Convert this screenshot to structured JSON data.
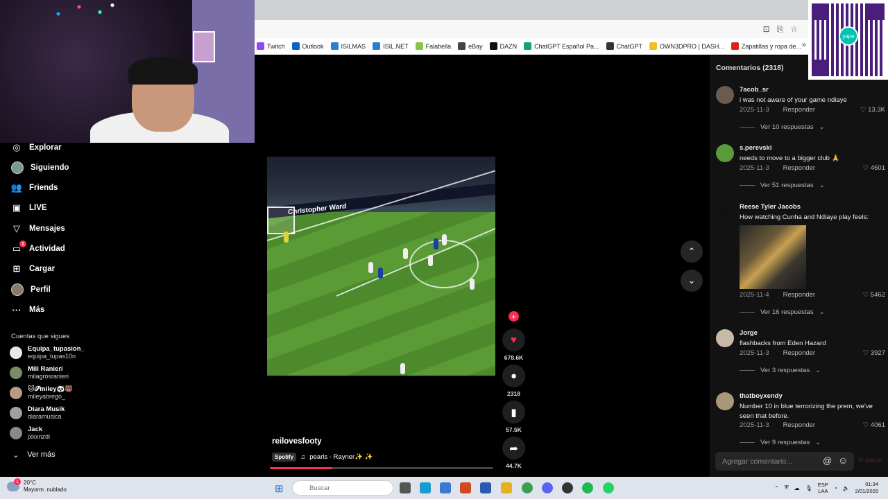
{
  "bookmarks": [
    {
      "label": "Twitch",
      "color": "#9146ff"
    },
    {
      "label": "Outlook",
      "color": "#0a64c8"
    },
    {
      "label": "ISILMAS",
      "color": "#2a7fd0"
    },
    {
      "label": "ISIL.NET",
      "color": "#2a7fd0"
    },
    {
      "label": "Falabella",
      "color": "#8bc34a"
    },
    {
      "label": "eBay",
      "color": "#444"
    },
    {
      "label": "DAZN",
      "color": "#111"
    },
    {
      "label": "ChatGPT Español Pa...",
      "color": "#10a37f"
    },
    {
      "label": "ChatGPT",
      "color": "#333"
    },
    {
      "label": "OWN3DPRO | DASH...",
      "color": "#f0c020"
    },
    {
      "label": "Zapatillas y ropa de...",
      "color": "#e02020"
    }
  ],
  "bookmarks_more": "»",
  "sidebar": {
    "nav": [
      {
        "label": "Explorar",
        "icon": "compass-icon",
        "glyph": "◎"
      },
      {
        "label": "Siguiendo",
        "icon": "following-avatar-icon",
        "glyph": ""
      },
      {
        "label": "Friends",
        "icon": "friends-icon",
        "glyph": "👥"
      },
      {
        "label": "LIVE",
        "icon": "live-icon",
        "glyph": "▣"
      },
      {
        "label": "Mensajes",
        "icon": "send-icon",
        "glyph": "▽"
      },
      {
        "label": "Actividad",
        "icon": "activity-icon",
        "glyph": "▭",
        "badge": "1"
      },
      {
        "label": "Cargar",
        "icon": "upload-icon",
        "glyph": "⊞"
      },
      {
        "label": "Perfil",
        "icon": "profile-avatar-icon",
        "glyph": ""
      },
      {
        "label": "Más",
        "icon": "more-icon",
        "glyph": "···"
      }
    ],
    "following_title": "Cuentas que sigues",
    "following": [
      {
        "name": "Equipa_tupasion_",
        "handle": "equipa_tupas10n",
        "color": "#e8e8e8"
      },
      {
        "name": "Mili Ranieri",
        "handle": "milagrosranieri",
        "color": "#7a8a6a"
      },
      {
        "name": "🐱𝓢miley🐼🐻",
        "handle": "mileyabrego_",
        "color": "#b89a8a"
      },
      {
        "name": "Diara Musik",
        "handle": "diaramusica",
        "color": "#a0a0a0"
      },
      {
        "name": "Jack",
        "handle": "jxkxnzdi",
        "color": "#8a8a8a"
      }
    ],
    "see_more": "Ver más"
  },
  "video": {
    "board_text": "Christopher Ward",
    "author": "reilovesfooty",
    "music_tag": "Spotify",
    "music": "pearls - Rayner✨ ✨",
    "progress": 0.28
  },
  "actions": {
    "likes": "678.6K",
    "comments": "2318",
    "saves": "57.5K",
    "shares": "44.7K"
  },
  "comments_panel": {
    "title": "Comentarios (2318)",
    "reply_label": "Responder",
    "items": [
      {
        "user": "7acob_sr",
        "text": "i was not aware of your game ndiaye",
        "date": "2025-11-3",
        "likes": "13.3K",
        "more": "Ver 10 respuestas",
        "avatar": "#6a5a50"
      },
      {
        "user": "s.perevski",
        "text": "needs to move to a bigger club 🙏",
        "date": "2025-11-3",
        "likes": "4601",
        "more": "Ver 51 respuestas",
        "avatar": "#5a9a3a"
      },
      {
        "user": "Reese Tyler Jacobs",
        "text": "How watching Cunha and Ndiaye play feels:",
        "date": "2025-11-4",
        "likes": "5462",
        "more": "Ver 16 respuestas",
        "avatar": "#111"
      },
      {
        "user": "Jorge",
        "text": "flashbacks from Eden Hazard",
        "date": "2025-11-3",
        "likes": "3927",
        "more": "Ver 3 respuestas",
        "avatar": "#c8b8a8"
      },
      {
        "user": "thatboyxendy",
        "text": "Number 10 in blue terrorizing the prem, we've seen that before.",
        "date": "2025-11-3",
        "likes": "4061",
        "more": "Ver 9 respuestas",
        "avatar": "#a89878"
      }
    ],
    "input_placeholder": "Agregar comentario...",
    "post": "Publicar"
  },
  "qr": {
    "logo_text": "yape"
  },
  "taskbar": {
    "weather_temp": "20°C",
    "weather_desc": "Mayorm. nublado",
    "weather_badge": "1",
    "search_placeholder": "Buscar",
    "lang1": "ESP",
    "lang2": "LAA",
    "time": "01:34",
    "date": "2/01/2026",
    "apps": [
      {
        "icon": "task-view-icon",
        "color": "#555"
      },
      {
        "icon": "edge-icon",
        "color": "#1a9ad0"
      },
      {
        "icon": "store-icon",
        "color": "#3a7ad0"
      },
      {
        "icon": "powerpoint-icon",
        "color": "#d04a20"
      },
      {
        "icon": "word-icon",
        "color": "#2a5ab0"
      },
      {
        "icon": "explorer-icon",
        "color": "#e8b020"
      },
      {
        "icon": "chrome-icon",
        "color": "#3aa050"
      },
      {
        "icon": "discord-icon",
        "color": "#5865f2"
      },
      {
        "icon": "steam-icon",
        "color": "#333"
      },
      {
        "icon": "spotify-icon",
        "color": "#1db954"
      },
      {
        "icon": "whatsapp-icon",
        "color": "#25d366"
      }
    ]
  }
}
